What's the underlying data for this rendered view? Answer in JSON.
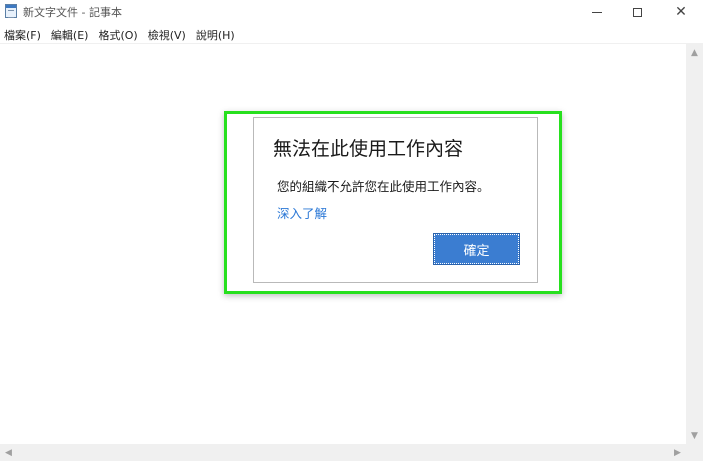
{
  "window": {
    "title": "新文字文件 - 記事本",
    "minimize_glyph": "—",
    "maximize_glyph": "☐",
    "close_glyph": "✕"
  },
  "menu": {
    "items": [
      {
        "label": "檔案(F)"
      },
      {
        "label": "編輯(E)"
      },
      {
        "label": "格式(O)"
      },
      {
        "label": "檢視(V)"
      },
      {
        "label": "說明(H)"
      }
    ]
  },
  "dialog": {
    "title": "無法在此使用工作內容",
    "message": "您的組織不允許您在此使用工作內容。",
    "link": "深入了解",
    "ok_label": "確定"
  },
  "icons": {
    "app": "notepad-icon",
    "scroll_up": "▲",
    "scroll_down": "▼",
    "scroll_left": "◀",
    "scroll_right": "▶"
  },
  "colors": {
    "highlight": "#27e01e",
    "button": "#3b7dd1",
    "link": "#2b78d6"
  }
}
